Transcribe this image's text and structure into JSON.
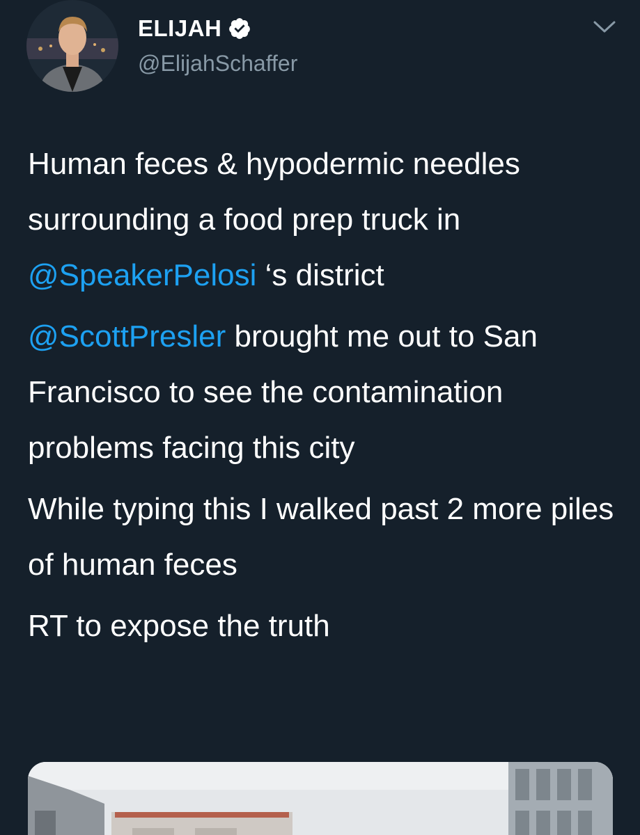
{
  "author": {
    "display_name": "ELIJAH",
    "handle": "@ElijahSchaffer",
    "verified": true,
    "avatar_icon": "profile-photo"
  },
  "menu_icon": "chevron-down-icon",
  "tweet": {
    "p1_a": "Human feces & hypodermic needles surrounding a food prep truck in ",
    "p1_mention": "@SpeakerPelosi",
    "p1_b": " ‘s district",
    "p2_mention": "@ScottPresler",
    "p2_b": " brought me out to San Francisco to see the contamination problems facing this city",
    "p3": "While typing this I walked past 2 more piles of human feces",
    "p4": "RT to expose the truth"
  },
  "colors": {
    "background": "#15202b",
    "text": "#ffffff",
    "secondary": "#8899a6",
    "link": "#1da1f2",
    "verified_badge": "#ffffff"
  }
}
